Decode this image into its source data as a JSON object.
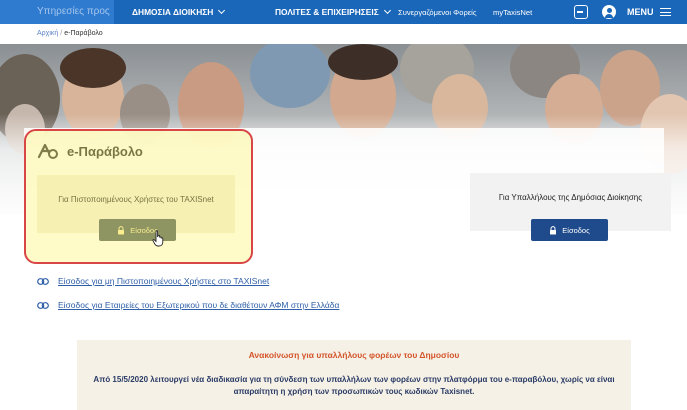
{
  "topbar": {
    "sector_label": "Υπηρεσίες προς",
    "nav": [
      {
        "label": "ΔΗΜΟΣΙΑ ΔΙΟΙΚΗΣΗ"
      },
      {
        "label": "ΠΟΛΙΤΕΣ & ΕΠΙΧΕΙΡΗΣΕΙΣ"
      }
    ],
    "links": [
      {
        "label": "Συνεργαζόμενοι Φορείς"
      },
      {
        "label": "myTaxisNet"
      }
    ],
    "menu_label": "MENU"
  },
  "breadcrumb": {
    "home": "Αρχική",
    "separator": "/",
    "current": "e-Παράβολο"
  },
  "page": {
    "title": "e-Παράβολο"
  },
  "login_boxes": [
    {
      "label": "Για Πιστοποιημένους Χρήστες του TAXISnet",
      "button": "Είσοδος"
    },
    {
      "label": "Για Υπαλλήλους της Δημόσιας Διοίκησης",
      "button": "Είσοδος"
    }
  ],
  "links": [
    {
      "label": "Είσοδος για μη Πιστοποιημένους Χρήστες στο TAXISnet"
    },
    {
      "label": "Είσοδος για Εταιρείες του Εξωτερικού που δε διαθέτουν ΑΦΜ στην Ελλάδα"
    }
  ],
  "announcement": {
    "title": "Ανακοίνωση για υπαλλήλους φορέων του Δημοσίου",
    "body": "Από 15/5/2020 λειτουργεί νέα διαδικασία για τη σύνδεση των υπαλλήλων των φορέων στην πλατφόρμα του e-παραβόλου, χωρίς να είναι απαραίτητη η χρήση των προσωπικών τους κωδικών Taxisnet."
  },
  "colors": {
    "topbar": "#1a66b8",
    "highlight_border": "#d84646",
    "highlight_fill": "#fff56e",
    "button_blue": "#1f4b8c",
    "button_gray": "#4b5a5c",
    "link": "#2f5fa8",
    "announcement_title": "#d4542a"
  },
  "icons": [
    "user-panel-icon",
    "user-account-icon",
    "menu-icon",
    "eparavolo-logo-icon",
    "lock-icon",
    "link-icon",
    "hand-cursor-icon"
  ]
}
